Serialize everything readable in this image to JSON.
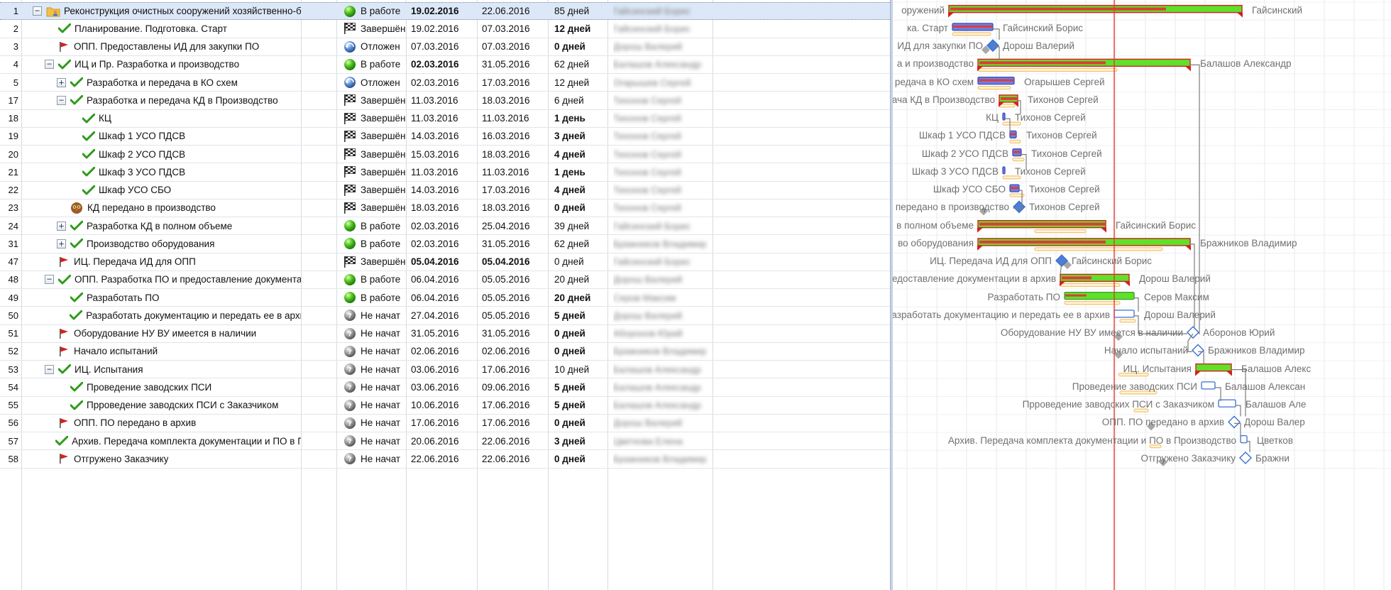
{
  "rows": [
    {
      "id": "1",
      "name": "Реконструкция очистных сооружений хозяйственно-бытовых и про",
      "status": "В работе",
      "status_icon": "green-ball",
      "start": "19.02.2016",
      "end": "22.06.2016",
      "dur": "85 дней",
      "res": "Гайсинский Борис",
      "level": 0,
      "toggle": "−",
      "icon": "folder-user",
      "bold_start": true,
      "bold_dur": false,
      "sel": true
    },
    {
      "id": "2",
      "name": "Планирование. Подготовка. Старт",
      "status": "Завершён",
      "status_icon": "checkered-flag",
      "start": "19.02.2016",
      "end": "07.03.2016",
      "dur": "12 дней",
      "res": "Гайсинский Борис",
      "level": 1,
      "toggle": "",
      "icon": "check",
      "bold_dur": true
    },
    {
      "id": "3",
      "name": "ОПП. Предоставлены ИД для закупки ПО",
      "status": "Отложен",
      "status_icon": "postponed",
      "start": "07.03.2016",
      "end": "07.03.2016",
      "dur": "0 дней",
      "res": "Дорош Валерий",
      "level": 1,
      "toggle": "",
      "icon": "flag",
      "bold_dur": true
    },
    {
      "id": "4",
      "name": "ИЦ и Пр. Разработка и производство",
      "status": "В работе",
      "status_icon": "green-ball",
      "start": "02.03.2016",
      "end": "31.05.2016",
      "dur": "62 дней",
      "res": "Балашов Александр",
      "level": 1,
      "toggle": "−",
      "icon": "check",
      "bold_start": true
    },
    {
      "id": "5",
      "name": "Разработка и передача в КО схем",
      "status": "Отложен",
      "status_icon": "postponed",
      "start": "02.03.2016",
      "end": "17.03.2016",
      "dur": "12 дней",
      "res": "Огарышев Сергей",
      "level": 2,
      "toggle": "+",
      "icon": "check"
    },
    {
      "id": "17",
      "name": "Разработка и передача КД в Производство",
      "status": "Завершён",
      "status_icon": "checkered-flag",
      "start": "11.03.2016",
      "end": "18.03.2016",
      "dur": "6 дней",
      "res": "Тихонов Сергей",
      "level": 2,
      "toggle": "−",
      "icon": "check"
    },
    {
      "id": "18",
      "name": "КЦ",
      "status": "Завершён",
      "status_icon": "checkered-flag",
      "start": "11.03.2016",
      "end": "11.03.2016",
      "dur": "1 день",
      "res": "Тихонов Сергей",
      "level": 3,
      "toggle": "",
      "icon": "check",
      "bold_dur": true
    },
    {
      "id": "19",
      "name": "Шкаф 1 УСО ПДСВ",
      "status": "Завершён",
      "status_icon": "checkered-flag",
      "start": "14.03.2016",
      "end": "16.03.2016",
      "dur": "3 дней",
      "res": "Тихонов Сергей",
      "level": 3,
      "toggle": "",
      "icon": "check",
      "bold_dur": true
    },
    {
      "id": "20",
      "name": "Шкаф 2 УСО ПДСВ",
      "status": "Завершён",
      "status_icon": "checkered-flag",
      "start": "15.03.2016",
      "end": "18.03.2016",
      "dur": "4 дней",
      "res": "Тихонов Сергей",
      "level": 3,
      "toggle": "",
      "icon": "check",
      "bold_dur": true
    },
    {
      "id": "21",
      "name": "Шкаф 3 УСО ПДСВ",
      "status": "Завершён",
      "status_icon": "checkered-flag",
      "start": "11.03.2016",
      "end": "11.03.2016",
      "dur": "1 день",
      "res": "Тихонов Сергей",
      "level": 3,
      "toggle": "",
      "icon": "check",
      "bold_dur": true
    },
    {
      "id": "22",
      "name": "Шкаф УСО СБО",
      "status": "Завершён",
      "status_icon": "checkered-flag",
      "start": "14.03.2016",
      "end": "17.03.2016",
      "dur": "4 дней",
      "res": "Тихонов Сергей",
      "level": 3,
      "toggle": "",
      "icon": "check",
      "bold_dur": true
    },
    {
      "id": "23",
      "name": "КД передано в производство",
      "status": "Завершён",
      "status_icon": "checkered-flag",
      "start": "18.03.2016",
      "end": "18.03.2016",
      "dur": "0 дней",
      "res": "Тихонов Сергей",
      "level": 2,
      "toggle": "",
      "icon": "milestone-owl",
      "bold_dur": true
    },
    {
      "id": "24",
      "name": "Разработка КД в полном объеме",
      "status": "В работе",
      "status_icon": "green-ball",
      "start": "02.03.2016",
      "end": "25.04.2016",
      "dur": "39 дней",
      "res": "Гайсинский Борис",
      "level": 2,
      "toggle": "+",
      "icon": "check"
    },
    {
      "id": "31",
      "name": "Производство оборудования",
      "status": "В работе",
      "status_icon": "green-ball",
      "start": "02.03.2016",
      "end": "31.05.2016",
      "dur": "62 дней",
      "res": "Бражников Владимир",
      "level": 2,
      "toggle": "+",
      "icon": "check"
    },
    {
      "id": "47",
      "name": "ИЦ. Передача ИД для ОПП",
      "status": "Завершён",
      "status_icon": "checkered-flag",
      "start": "05.04.2016",
      "end": "05.04.2016",
      "dur": "0 дней",
      "res": "Гайсинский Борис",
      "level": 1,
      "toggle": "",
      "icon": "flag",
      "bold_start": true,
      "bold_end": true
    },
    {
      "id": "48",
      "name": "ОПП. Разработка ПО и предоставление документации в архив",
      "status": "В работе",
      "status_icon": "green-ball",
      "start": "06.04.2016",
      "end": "05.05.2016",
      "dur": "20 дней",
      "res": "Дорош Валерий",
      "level": 1,
      "toggle": "−",
      "icon": "check"
    },
    {
      "id": "49",
      "name": "Разработать ПО",
      "status": "В работе",
      "status_icon": "green-ball",
      "start": "06.04.2016",
      "end": "05.05.2016",
      "dur": "20 дней",
      "res": "Серов Максим",
      "level": 2,
      "toggle": "",
      "icon": "check",
      "bold_dur": true
    },
    {
      "id": "50",
      "name": "Разработать документацию и передать ее в архив",
      "status": "Не начат",
      "status_icon": "grey-ball",
      "start": "27.04.2016",
      "end": "05.05.2016",
      "dur": "5 дней",
      "res": "Дорош Валерий",
      "level": 2,
      "toggle": "",
      "icon": "check",
      "bold_dur": true
    },
    {
      "id": "51",
      "name": "Оборудование НУ ВУ имеется в наличии",
      "status": "Не начат",
      "status_icon": "grey-ball",
      "start": "31.05.2016",
      "end": "31.05.2016",
      "dur": "0 дней",
      "res": "Аборонов Юрий",
      "level": 1,
      "toggle": "",
      "icon": "flag",
      "bold_dur": true
    },
    {
      "id": "52",
      "name": "Начало испытаний",
      "status": "Не начат",
      "status_icon": "grey-ball",
      "start": "02.06.2016",
      "end": "02.06.2016",
      "dur": "0 дней",
      "res": "Бражников Владимир",
      "level": 1,
      "toggle": "",
      "icon": "flag",
      "bold_dur": true
    },
    {
      "id": "53",
      "name": "ИЦ. Испытания",
      "status": "Не начат",
      "status_icon": "grey-ball",
      "start": "03.06.2016",
      "end": "17.06.2016",
      "dur": "10 дней",
      "res": "Балашов Александр",
      "level": 1,
      "toggle": "−",
      "icon": "check"
    },
    {
      "id": "54",
      "name": "Проведение заводских ПСИ",
      "status": "Не начат",
      "status_icon": "grey-ball",
      "start": "03.06.2016",
      "end": "09.06.2016",
      "dur": "5 дней",
      "res": "Балашов Александр",
      "level": 2,
      "toggle": "",
      "icon": "check",
      "bold_dur": true
    },
    {
      "id": "55",
      "name": "Прроведение заводских ПСИ с Заказчиком",
      "status": "Не начат",
      "status_icon": "grey-ball",
      "start": "10.06.2016",
      "end": "17.06.2016",
      "dur": "5 дней",
      "res": "Балашов Александр",
      "level": 2,
      "toggle": "",
      "icon": "check",
      "bold_dur": true
    },
    {
      "id": "56",
      "name": "ОПП. ПО передано в архив",
      "status": "Не начат",
      "status_icon": "grey-ball",
      "start": "17.06.2016",
      "end": "17.06.2016",
      "dur": "0 дней",
      "res": "Дорош Валерий",
      "level": 1,
      "toggle": "",
      "icon": "flag",
      "bold_dur": true
    },
    {
      "id": "57",
      "name": "Архив. Передача комплекта документации и ПО в Производство",
      "status": "Не начат",
      "status_icon": "grey-ball",
      "start": "20.06.2016",
      "end": "22.06.2016",
      "dur": "3 дней",
      "res": "Цветкова Елена",
      "level": 1,
      "toggle": "",
      "icon": "check",
      "bold_dur": true
    },
    {
      "id": "58",
      "name": "Отгружено Заказчику",
      "status": "Не начат",
      "status_icon": "grey-ball",
      "start": "22.06.2016",
      "end": "22.06.2016",
      "dur": "0 дней",
      "res": "Бражников Владимир",
      "level": 1,
      "toggle": "",
      "icon": "flag",
      "bold_dur": true
    }
  ],
  "gantt": {
    "items": [
      {
        "label": "оружений",
        "res": "Гайсинский",
        "type": "summary"
      },
      {
        "label": "ка. Старт",
        "res": "Гайсинский Борис",
        "type": "task"
      },
      {
        "label": "ИД для закупки ПО",
        "res": "Дорош Валерий",
        "type": "milestone"
      },
      {
        "label": "а и производство",
        "res": "Балашов Александр",
        "type": "summary"
      },
      {
        "label": "редача в КО схем",
        "res": "Огарышев Сергей",
        "type": "task"
      },
      {
        "label": "ача КД в Производство",
        "res": "Тихонов Сергей",
        "type": "summary"
      },
      {
        "label": "КЦ",
        "res": "Тихонов Сергей",
        "type": "task"
      },
      {
        "label": "Шкаф 1 УСО ПДСВ",
        "res": "Тихонов Сергей",
        "type": "task"
      },
      {
        "label": "Шкаф 2 УСО ПДСВ",
        "res": "Тихонов Сергей",
        "type": "task"
      },
      {
        "label": "Шкаф 3 УСО ПДСВ",
        "res": "Тихонов Сергей",
        "type": "task"
      },
      {
        "label": "Шкаф УСО СБО",
        "res": "Тихонов Сергей",
        "type": "task"
      },
      {
        "label": "передано в производство",
        "res": "Тихонов Сергей",
        "type": "milestone"
      },
      {
        "label": "в полном объеме",
        "res": "Гайсинский Борис",
        "type": "summary"
      },
      {
        "label": "во оборудования",
        "res": "Бражников Владимир",
        "type": "summary"
      },
      {
        "label": "ИЦ. Передача ИД для ОПП",
        "res": "Гайсинский Борис",
        "type": "milestone"
      },
      {
        "label": "предоставление документации в архив",
        "res": "Дорош Валерий",
        "type": "summary"
      },
      {
        "label": "Разработать ПО",
        "res": "Серов Максим",
        "type": "task"
      },
      {
        "label": "Разработать документацию и передать ее в архив",
        "res": "Дорош Валерий",
        "type": "task"
      },
      {
        "label": "Оборудование НУ ВУ имеется в наличии",
        "res": "Аборонов Юрий",
        "type": "milestone"
      },
      {
        "label": "Начало испытаний",
        "res": "Бражников Владимир",
        "type": "milestone"
      },
      {
        "label": "ИЦ. Испытания",
        "res": "Балашов Алекс",
        "type": "summary"
      },
      {
        "label": "Проведение заводских ПСИ",
        "res": "Балашов Алексан",
        "type": "task"
      },
      {
        "label": "Прроведение заводских ПСИ с Заказчиком",
        "res": "Балашов Але",
        "type": "task"
      },
      {
        "label": "ОПП. ПО передано в архив",
        "res": "Дорош Валер",
        "type": "milestone"
      },
      {
        "label": "Архив. Передача комплекта документации и ПО в Производство",
        "res": "Цветков",
        "type": "task"
      },
      {
        "label": "Отгружено Заказчику",
        "res": "Бражни",
        "type": "milestone"
      }
    ]
  },
  "colors": {
    "progress_green": "#5fe12a",
    "progress_red": "#e03a3a",
    "today_line": "#e53935",
    "baseline": "#f2c46b",
    "milestone": "#4a7fd8"
  }
}
